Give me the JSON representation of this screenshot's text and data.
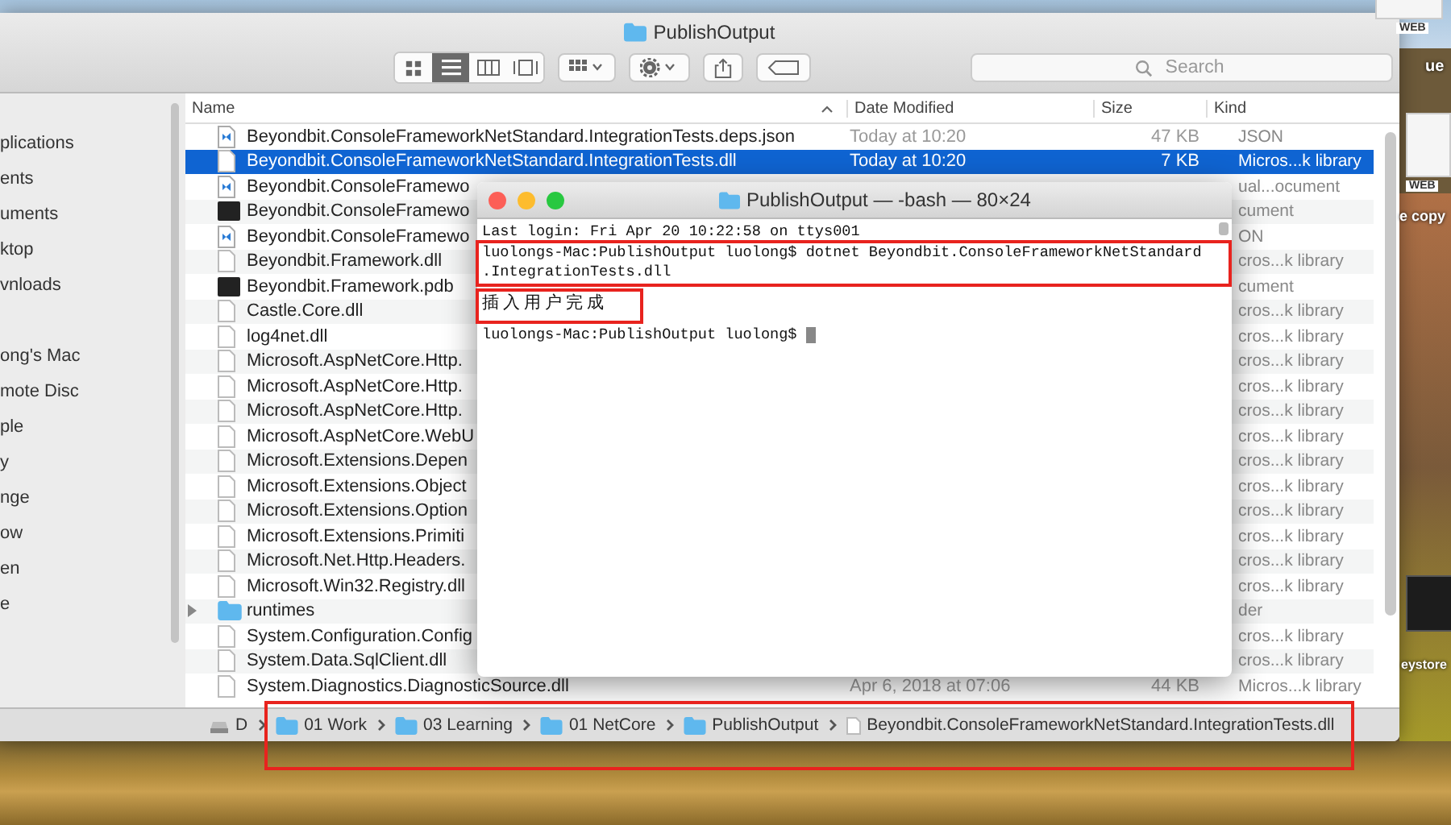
{
  "finder": {
    "title": "PublishOutput",
    "search": {
      "placeholder": "Search"
    },
    "sidebar": {
      "items": [
        "plications",
        "ents",
        "uments",
        "ktop",
        "vnloads",
        "ong's Mac",
        "mote Disc",
        "ple",
        "y",
        "nge",
        "ow",
        "en",
        "e"
      ]
    },
    "columns": [
      "Name",
      "Date Modified",
      "Size",
      "Kind"
    ],
    "rows": [
      {
        "kind": "code",
        "name": "Beyondbit.ConsoleFrameworkNetStandard.IntegrationTests.deps.json",
        "date": "Today at 10:20",
        "size": "47 KB",
        "file_kind": "JSON",
        "selected": false
      },
      {
        "kind": "doc",
        "name": "Beyondbit.ConsoleFrameworkNetStandard.IntegrationTests.dll",
        "date": "Today at 10:20",
        "size": "7 KB",
        "file_kind": "Micros...k library",
        "selected": true
      },
      {
        "kind": "code",
        "name": "Beyondbit.ConsoleFramewo",
        "file_kind": "ual...ocument",
        "selected": false
      },
      {
        "kind": "exec",
        "name": "Beyondbit.ConsoleFramewo",
        "file_kind": "cument",
        "selected": false
      },
      {
        "kind": "code",
        "name": "Beyondbit.ConsoleFramewo",
        "file_kind": "ON",
        "selected": false
      },
      {
        "kind": "doc",
        "name": "Beyondbit.Framework.dll",
        "file_kind": "cros...k library",
        "selected": false
      },
      {
        "kind": "exec",
        "name": "Beyondbit.Framework.pdb",
        "file_kind": "cument",
        "selected": false
      },
      {
        "kind": "doc",
        "name": "Castle.Core.dll",
        "file_kind": "cros...k library",
        "selected": false
      },
      {
        "kind": "doc",
        "name": "log4net.dll",
        "file_kind": "cros...k library",
        "selected": false
      },
      {
        "kind": "doc",
        "name": "Microsoft.AspNetCore.Http.",
        "file_kind": "cros...k library",
        "selected": false
      },
      {
        "kind": "doc",
        "name": "Microsoft.AspNetCore.Http.",
        "file_kind": "cros...k library",
        "selected": false
      },
      {
        "kind": "doc",
        "name": "Microsoft.AspNetCore.Http.",
        "file_kind": "cros...k library",
        "selected": false
      },
      {
        "kind": "doc",
        "name": "Microsoft.AspNetCore.WebU",
        "file_kind": "cros...k library",
        "selected": false
      },
      {
        "kind": "doc",
        "name": "Microsoft.Extensions.Depen",
        "file_kind": "cros...k library",
        "selected": false
      },
      {
        "kind": "doc",
        "name": "Microsoft.Extensions.Object",
        "file_kind": "cros...k library",
        "selected": false
      },
      {
        "kind": "doc",
        "name": "Microsoft.Extensions.Option",
        "file_kind": "cros...k library",
        "selected": false
      },
      {
        "kind": "doc",
        "name": "Microsoft.Extensions.Primiti",
        "file_kind": "cros...k library",
        "selected": false
      },
      {
        "kind": "doc",
        "name": "Microsoft.Net.Http.Headers.",
        "file_kind": "cros...k library",
        "selected": false
      },
      {
        "kind": "doc",
        "name": "Microsoft.Win32.Registry.dll",
        "file_kind": "cros...k library",
        "selected": false
      },
      {
        "kind": "folder",
        "name": "runtimes",
        "file_kind": "der",
        "selected": false,
        "expanded": false
      },
      {
        "kind": "doc",
        "name": "System.Configuration.Config",
        "file_kind": "cros...k library",
        "selected": false
      },
      {
        "kind": "doc",
        "name": "System.Data.SqlClient.dll",
        "file_kind": "cros...k library",
        "selected": false
      },
      {
        "kind": "doc",
        "name": "System.Diagnostics.DiagnosticSource.dll",
        "date": "Apr 6, 2018 at 07:06",
        "size": "44 KB",
        "file_kind": "Micros...k library",
        "selected": false
      }
    ],
    "path": [
      {
        "kind": "disk",
        "label": "D"
      },
      {
        "kind": "folder",
        "label": "01 Work"
      },
      {
        "kind": "folder",
        "label": "03 Learning"
      },
      {
        "kind": "folder",
        "label": "01 NetCore"
      },
      {
        "kind": "folder",
        "label": "PublishOutput"
      },
      {
        "kind": "doc",
        "label": "Beyondbit.ConsoleFrameworkNetStandard.IntegrationTests.dll"
      }
    ]
  },
  "terminal": {
    "title": "PublishOutput — -bash — 80×24",
    "lines": [
      "Last login: Fri Apr 20 10:22:58 on ttys001",
      "luolongs-Mac:PublishOutput luolong$ dotnet Beyondbit.ConsoleFrameworkNetStandard",
      ".IntegrationTests.dll",
      "插入用户完成",
      "luolongs-Mac:PublishOutput luolong$"
    ]
  },
  "desktop_labels": [
    "WEB",
    "ue",
    "WEB",
    "e copy",
    "eystore"
  ]
}
